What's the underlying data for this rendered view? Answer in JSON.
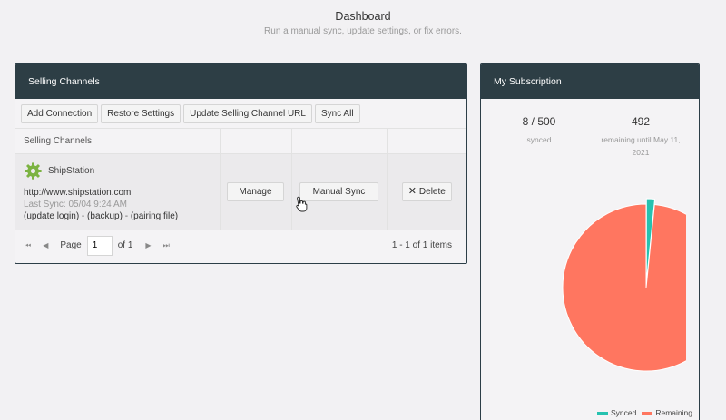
{
  "header": {
    "title": "Dashboard",
    "subtitle": "Run a manual sync, update settings, or fix errors."
  },
  "channels_panel": {
    "title": "Selling Channels",
    "toolbar": {
      "add_connection": "Add Connection",
      "restore_settings": "Restore Settings",
      "update_url": "Update Selling Channel URL",
      "sync_all": "Sync All"
    },
    "column_header": "Selling Channels",
    "row": {
      "name": "ShipStation",
      "url": "http://www.shipstation.com",
      "last_sync": "Last Sync: 05/04 9:24 AM",
      "update_login": "(update login)",
      "separator": " - ",
      "backup": "(backup)",
      "pairing_file": "(pairing file)",
      "manage": "Manage",
      "manual_sync": "Manual Sync",
      "delete": "Delete",
      "icon": "gear-icon"
    },
    "pager": {
      "page_label": "Page",
      "page_value": "1",
      "of_label": "of 1",
      "items_label": "1 - 1 of 1 items"
    }
  },
  "subscription_panel": {
    "title": "My Subscription",
    "synced_value": "8 / 500",
    "synced_label": "synced",
    "remaining_value": "492",
    "remaining_label_line1": "remaining until May 11,",
    "remaining_label_line2": "2021",
    "legend_synced": "Synced",
    "legend_remaining": "Remaining"
  },
  "chart_data": {
    "type": "pie",
    "categories": [
      "Synced",
      "Remaining"
    ],
    "values": [
      8,
      492
    ],
    "colors": [
      "#26c2b0",
      "#ff7660"
    ],
    "legend": "bottom-right"
  }
}
